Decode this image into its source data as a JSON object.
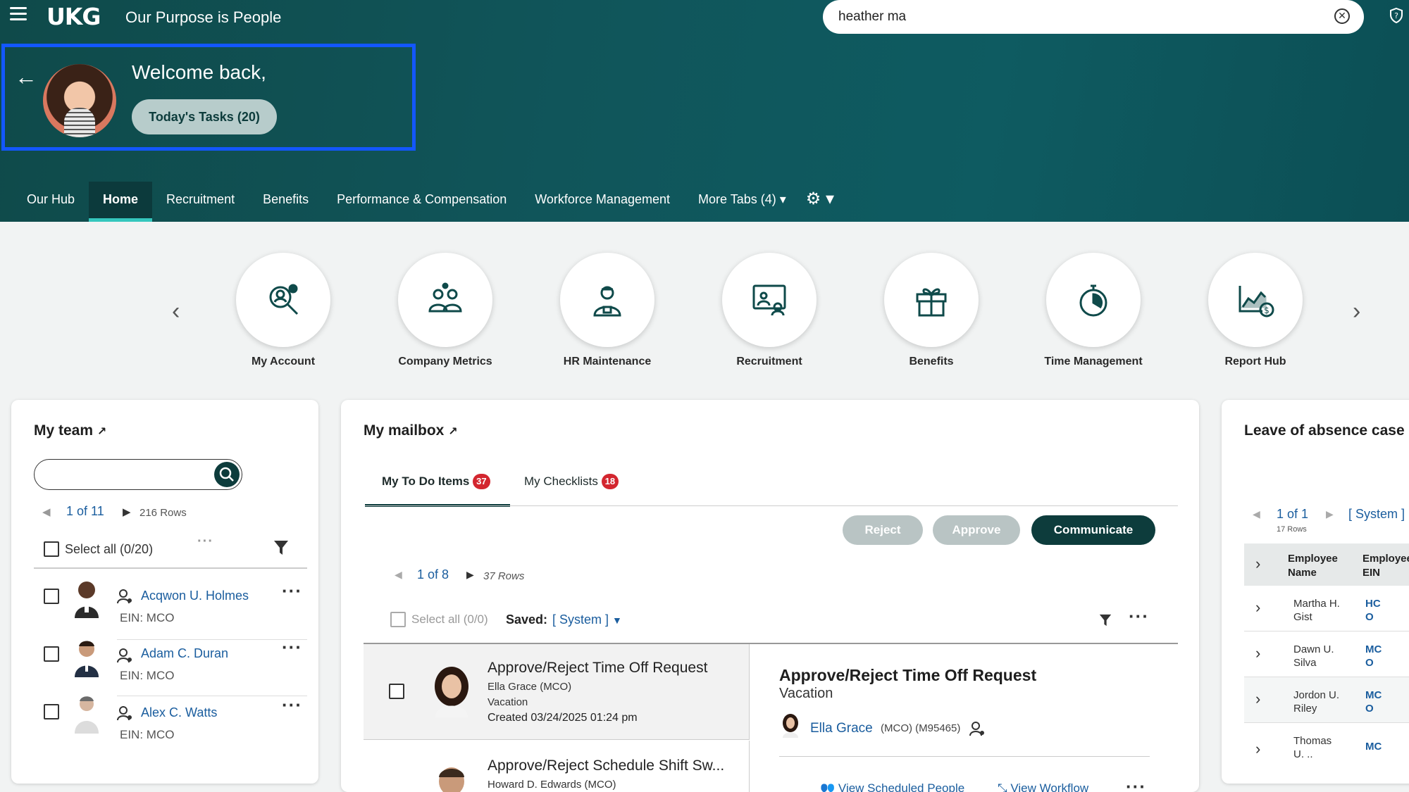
{
  "app": {
    "logo": "UKG",
    "tagline": "Our Purpose is People",
    "search_value": "heather ma"
  },
  "welcome": {
    "text": "Welcome back,",
    "tasks_button": "Today's Tasks (20)"
  },
  "tabs": [
    "Our Hub",
    "Home",
    "Recruitment",
    "Benefits",
    "Performance & Compensation",
    "Workforce Management",
    "More Tabs  (4)"
  ],
  "quick_links": [
    "My Account",
    "Company Metrics",
    "HR Maintenance",
    "Recruitment",
    "Benefits",
    "Time Management",
    "Report Hub"
  ],
  "my_team": {
    "title": "My team",
    "pager": "1 of 11",
    "rows": "216 Rows",
    "select_all": "Select all (0/20)",
    "members": [
      {
        "name": "Acqwon U. Holmes",
        "ein": "EIN: MCO"
      },
      {
        "name": "Adam C. Duran",
        "ein": "EIN: MCO"
      },
      {
        "name": "Alex C. Watts",
        "ein": "EIN: MCO"
      }
    ]
  },
  "mailbox": {
    "title": "My mailbox",
    "tab_todo": "My To Do Items",
    "todo_count": "37",
    "tab_checklists": "My Checklists",
    "checklist_count": "18",
    "reject": "Reject",
    "approve": "Approve",
    "communicate": "Communicate",
    "pager": "1 of 8",
    "rows": "37 Rows",
    "select_all": "Select all (0/0)",
    "saved_label": "Saved:",
    "saved_value": "[ System ]",
    "items": [
      {
        "title": "Approve/Reject Time Off Request",
        "person": "Ella Grace (MCO)",
        "type": "Vacation",
        "created": "Created 03/24/2025 01:24 pm"
      },
      {
        "title": "Approve/Reject Schedule Shift Sw...",
        "person": "Howard D. Edwards (MCO)"
      }
    ],
    "detail": {
      "title": "Approve/Reject Time Off Request",
      "subtitle": "Vacation",
      "person": "Ella Grace",
      "person_meta": "(MCO) (M95465)",
      "link1": "View Scheduled People",
      "link2": "View Workflow"
    }
  },
  "leave": {
    "title": "Leave of absence case",
    "pager": "1 of 1",
    "saved": "[ System ]",
    "rows": "17 Rows",
    "col1": "Employee Name",
    "col2": "Employee EIN",
    "records": [
      {
        "name": "Martha H. Gist",
        "ein": "HC O"
      },
      {
        "name": "Dawn U. Silva",
        "ein": "MC O"
      },
      {
        "name": "Jordon U. Riley",
        "ein": "MC O"
      },
      {
        "name": "Thomas U. ..",
        "ein": "MC"
      }
    ]
  },
  "colors": {
    "header": "#0f4f54",
    "accent": "#35c6bd",
    "primary_button": "#0d3c3c",
    "badge": "#d3262f",
    "link": "#1a5d9e",
    "highlight_border": "#1357ff"
  },
  "icons": [
    "menu-icon",
    "search-icon",
    "close-icon",
    "help-icon",
    "back-arrow-icon",
    "gear-icon",
    "chevron-left-icon",
    "chevron-right-icon",
    "filter-icon",
    "person-icon"
  ]
}
